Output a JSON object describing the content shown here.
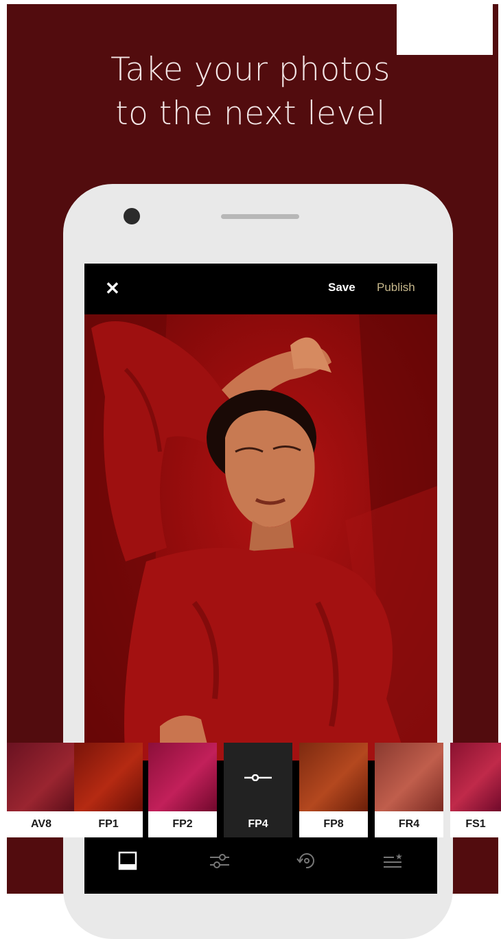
{
  "promo": {
    "headline_line1": "Take your photos",
    "headline_line2": "to the next level"
  },
  "editor": {
    "close_icon": "close-icon",
    "save_label": "Save",
    "publish_label": "Publish",
    "photo_icon": "portrait-photo"
  },
  "filters": [
    {
      "label": "AV8",
      "color": "#7a1620",
      "selected": false
    },
    {
      "label": "FP1",
      "color": "#8f1a0d",
      "selected": false
    },
    {
      "label": "FP2",
      "color": "#a0103e",
      "selected": false
    },
    {
      "label": "FP4",
      "color": "#222222",
      "selected": true,
      "icon": "slider-icon"
    },
    {
      "label": "FP8",
      "color": "#983114",
      "selected": false
    },
    {
      "label": "FR4",
      "color": "#a44436",
      "selected": false
    },
    {
      "label": "FS1",
      "color": "#a31838",
      "selected": false
    }
  ],
  "tabs": [
    {
      "name": "filters-tab",
      "icon": "square-frame-icon",
      "active": true
    },
    {
      "name": "adjust-tab",
      "icon": "sliders-icon",
      "active": false
    },
    {
      "name": "history-tab",
      "icon": "history-icon",
      "active": false
    },
    {
      "name": "recipes-tab",
      "icon": "list-star-icon",
      "active": false
    }
  ],
  "colors": {
    "background": "#520c0e",
    "publish": "#c7b88c",
    "phone_body": "#e9e9e9"
  }
}
